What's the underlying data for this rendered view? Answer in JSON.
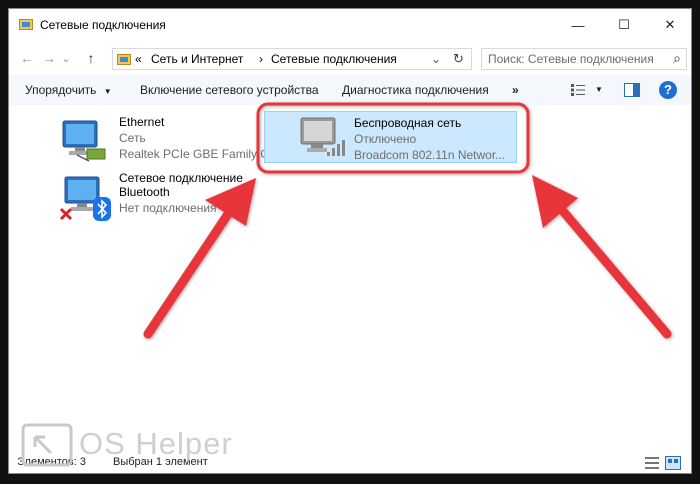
{
  "window": {
    "title": "Сетевые подключения",
    "minimize_glyph": "—",
    "maximize_glyph": "☐",
    "close_glyph": "✕"
  },
  "addressbar": {
    "back_glyph": "←",
    "forward_glyph": "→",
    "dropdown_glyph": "⌄",
    "up_glyph": "↑",
    "separator_left": "«",
    "crumbs": [
      "Сеть и Интернет",
      "Сетевые подключения"
    ],
    "crumb_separator": "›",
    "refresh_glyph": "↻",
    "search_placeholder": "Поиск: Сетевые подключения",
    "search_glyph": "⌕"
  },
  "toolbar": {
    "organize": "Упорядочить",
    "organize_arrow": "▼",
    "enable_device": "Включение сетевого устройства",
    "diagnose": "Диагностика подключения",
    "more": "»",
    "view_arrow": "▼",
    "help": "?"
  },
  "connections": [
    {
      "name": "Ethernet",
      "status": "Сеть",
      "device": "Realtek PCIe GBE Family C..."
    },
    {
      "name": "Беспроводная сеть",
      "status": "Отключено",
      "device": "Broadcom 802.11n Networ..."
    },
    {
      "name": "Сетевое подключение",
      "name2": "Bluetooth",
      "status": "Нет подключения",
      "device": ""
    }
  ],
  "statusbar": {
    "count": "Элементов: 3",
    "selected": "Выбран 1 элемент"
  },
  "watermark": {
    "text": "OS Helper"
  },
  "colors": {
    "annotation_red": "#e8343b",
    "selection_bg": "#cce8ff",
    "selection_border": "#99d1ff",
    "help_blue": "#1e6fd1",
    "bluetooth_blue": "#1a73e8",
    "error_red": "#d8232a",
    "toolbar_bg": "#f4f7fc"
  }
}
